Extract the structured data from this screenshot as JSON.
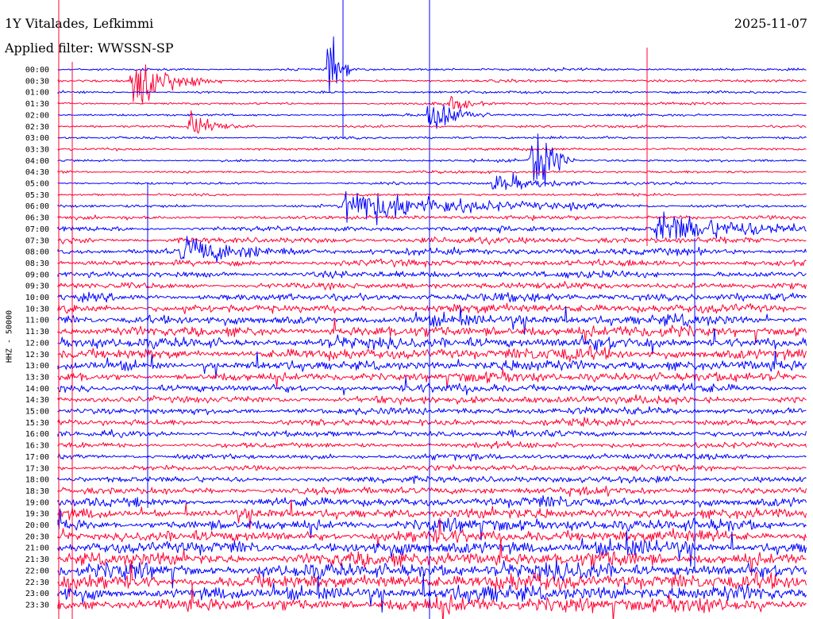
{
  "header": {
    "station": "1Y Vitalades, Lefkimmi",
    "date": "2025-11-07",
    "filter": "Applied filter: WWSSN-SP"
  },
  "chart_data": {
    "type": "line",
    "title": "1Y Vitalades, Lefkimmi",
    "ylabel": "HHZ - 50000",
    "tick_labels": [
      "00:00",
      "00:30",
      "01:00",
      "01:30",
      "02:00",
      "02:30",
      "03:00",
      "03:30",
      "04:00",
      "04:30",
      "05:00",
      "05:30",
      "06:00",
      "06:30",
      "07:00",
      "07:30",
      "08:00",
      "08:30",
      "09:00",
      "09:30",
      "10:00",
      "10:30",
      "11:00",
      "11:30",
      "12:00",
      "12:30",
      "13:00",
      "13:30",
      "14:00",
      "14:30",
      "15:00",
      "15:30",
      "16:00",
      "16:30",
      "17:00",
      "17:30",
      "18:00",
      "18:30",
      "19:00",
      "19:30",
      "20:00",
      "20:30",
      "21:00",
      "21:30",
      "22:00",
      "22:30",
      "23:00",
      "23:30"
    ],
    "trace_colors": [
      "#0000ff",
      "#ff0033"
    ],
    "noise_level": [
      1,
      1,
      1,
      1,
      1,
      1,
      1,
      1,
      1,
      1,
      1,
      1,
      1.3,
      1.6,
      2,
      2.4,
      2.6,
      2.6,
      2.6,
      2.6,
      3,
      3.4,
      4,
      4.2,
      4.4,
      4.4,
      4,
      3.6,
      3.2,
      3,
      2.8,
      2.6,
      2.4,
      2.2,
      2.2,
      2.2,
      2.6,
      3,
      3.6,
      4,
      4.4,
      4.8,
      5.2,
      5.6,
      5.8,
      6,
      5.8,
      5.6
    ],
    "events": [
      {
        "row": 1,
        "minute": 3.0,
        "amplitude": 28,
        "duration": 1.2
      },
      {
        "row": 0,
        "minute": 10.9,
        "amplitude": 40,
        "duration": 0.3
      },
      {
        "row": 4,
        "minute": 14.9,
        "amplitude": 22,
        "duration": 0.8
      },
      {
        "row": 8,
        "minute": 19.0,
        "amplitude": 42,
        "duration": 0.6
      },
      {
        "row": 5,
        "minute": 5.3,
        "amplitude": 12,
        "duration": 0.9
      },
      {
        "row": 12,
        "minute": 11.5,
        "amplitude": 18,
        "duration": 3.5
      },
      {
        "row": 14,
        "minute": 24.0,
        "amplitude": 14,
        "duration": 3.0
      },
      {
        "row": 16,
        "minute": 5.0,
        "amplitude": 12,
        "duration": 2.0
      },
      {
        "row": 10,
        "minute": 17.5,
        "amplitude": 9,
        "duration": 1.5
      },
      {
        "row": 3,
        "minute": 15.7,
        "amplitude": 9,
        "duration": 0.5
      }
    ]
  }
}
